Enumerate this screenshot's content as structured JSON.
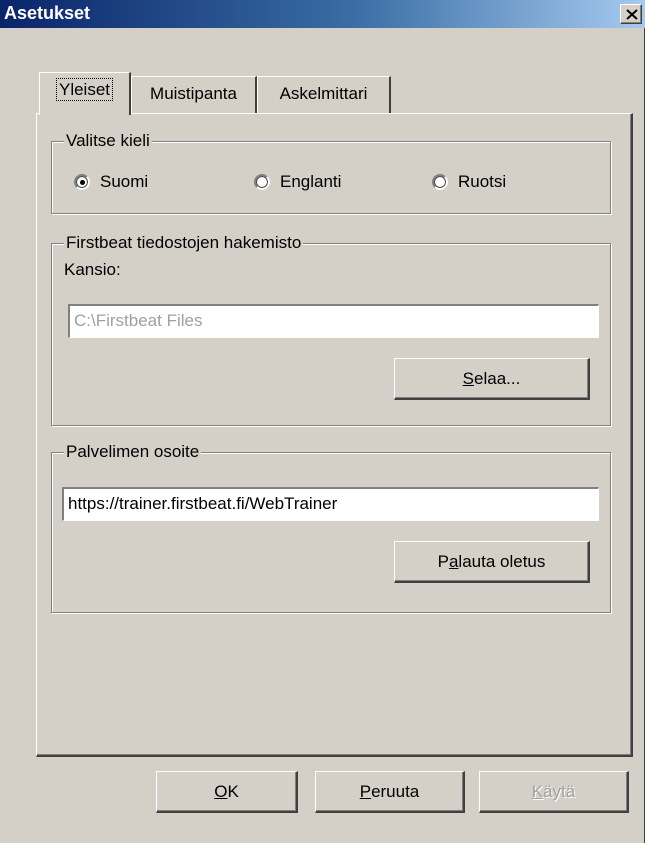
{
  "window": {
    "title": "Asetukset"
  },
  "tabs": {
    "general": "Yleiset",
    "memory_belt": "Muistipanta",
    "pedometer": "Askelmittari"
  },
  "language_group": {
    "legend": "Valitse kieli",
    "options": [
      "Suomi",
      "Englanti",
      "Ruotsi"
    ],
    "selected": "Suomi"
  },
  "folder_group": {
    "legend": "Firstbeat tiedostojen hakemisto",
    "folder_label": "Kansio:",
    "folder_value": "C:\\Firstbeat Files",
    "browse": {
      "mnemonic": "S",
      "rest": "elaa..."
    }
  },
  "server_group": {
    "legend": "Palvelimen osoite",
    "address_value": "https://trainer.firstbeat.fi/WebTrainer",
    "reset": {
      "pre": "P",
      "mnemonic": "a",
      "rest": "lauta oletus"
    }
  },
  "footer": {
    "ok": {
      "mnemonic": "O",
      "rest": "K"
    },
    "cancel": {
      "mnemonic": "P",
      "rest": "eruuta"
    },
    "apply": {
      "mnemonic": "K",
      "rest": "äytä"
    }
  }
}
